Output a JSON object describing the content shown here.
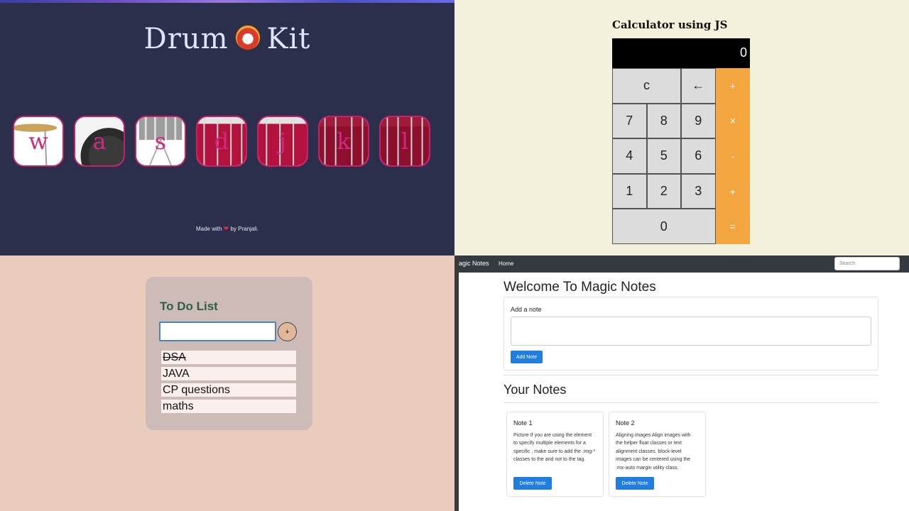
{
  "drum": {
    "title_left": "Drum",
    "title_right": "Kit",
    "keys": [
      "w",
      "a",
      "s",
      "d",
      "j",
      "k",
      "l"
    ],
    "footer_prefix": "Made with",
    "footer_heart": "❤",
    "footer_suffix": "by Pranjali."
  },
  "calculator": {
    "title": "Calculator using JS",
    "display": "0",
    "buttons": {
      "clear": "c",
      "back": "←",
      "plus1": "+",
      "n7": "7",
      "n8": "8",
      "n9": "9",
      "mul": "×",
      "n4": "4",
      "n5": "5",
      "n6": "6",
      "minus": "-",
      "n1": "1",
      "n2": "2",
      "n3": "3",
      "plus2": "+",
      "n0": "0",
      "equals": "="
    },
    "colors": {
      "operator": "#f3a640",
      "display_bg": "#000000",
      "page_bg": "#f4f2dd"
    }
  },
  "todo": {
    "title": "To Do List",
    "input_value": "",
    "add_label": "+",
    "items": [
      {
        "text": "DSA",
        "done": true
      },
      {
        "text": "JAVA",
        "done": false
      },
      {
        "text": "CP questions",
        "done": false
      },
      {
        "text": "maths",
        "done": false
      }
    ]
  },
  "notes": {
    "brand": "agic Notes",
    "nav_home": "Home",
    "search_placeholder": "Search",
    "heading": "Welcome To Magic Notes",
    "add_label": "Add a note",
    "textarea_value": "",
    "add_button": "Add Note",
    "your_notes": "Your Notes",
    "cards": [
      {
        "title": "Note 1",
        "body": "Picture If you are using the element to specify multiple elements for a specific , make sure to add the .img-* classes to the  and not to the tag.",
        "delete_label": "Delete Note"
      },
      {
        "title": "Note 2",
        "body": "Aligning images Align images with the helper float classes or text alignment classes. block-level images can be centered using the .mx-auto margin utility class.",
        "delete_label": "Delete Note"
      }
    ],
    "colors": {
      "primary_button": "#1f7ee0",
      "navbar": "#343a40"
    }
  }
}
